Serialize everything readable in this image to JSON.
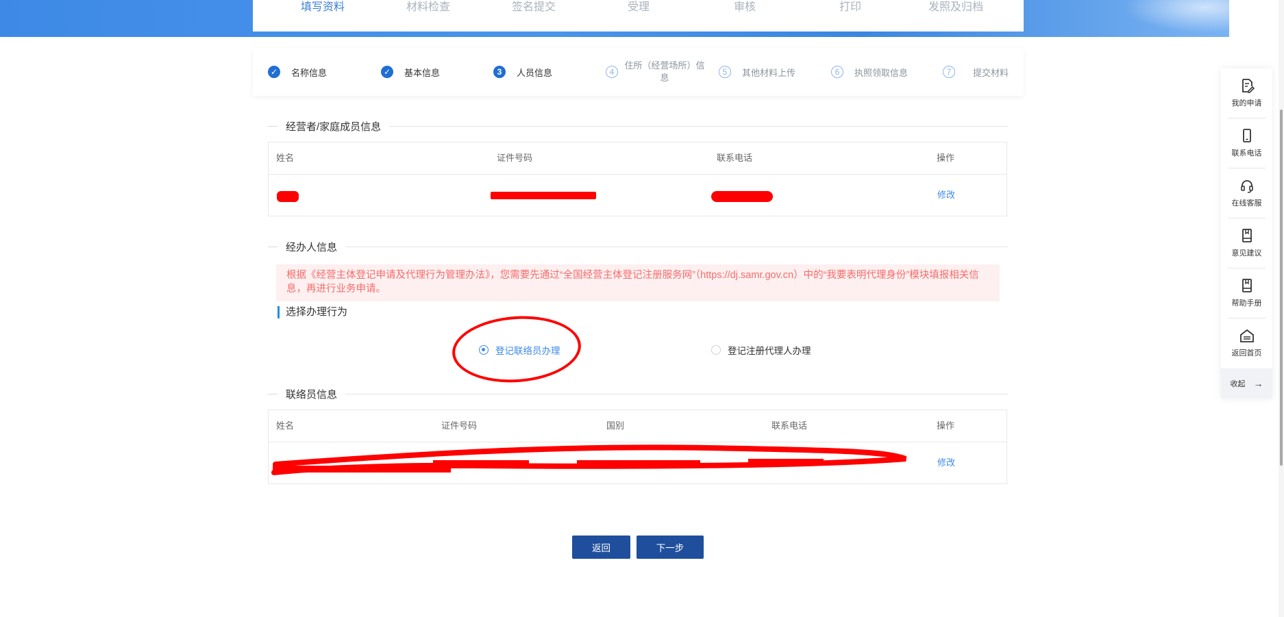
{
  "top_steps": [
    "填写资料",
    "材料检查",
    "签名提交",
    "受理",
    "审核",
    "打印",
    "发照及归档"
  ],
  "sub_steps": [
    {
      "num": "1",
      "label": "名称信息",
      "state": "done"
    },
    {
      "num": "2",
      "label": "基本信息",
      "state": "done"
    },
    {
      "num": "3",
      "label": "人员信息",
      "state": "current"
    },
    {
      "num": "4",
      "label": "住所（经营场所）信息",
      "state": "todo"
    },
    {
      "num": "5",
      "label": "其他材料上传",
      "state": "todo"
    },
    {
      "num": "6",
      "label": "执照领取信息",
      "state": "todo"
    },
    {
      "num": "7",
      "label": "提交材料",
      "state": "todo"
    }
  ],
  "operator_section": {
    "title": "经营者/家庭成员信息",
    "headers": [
      "姓名",
      "证件号码",
      "联系电话",
      "操作"
    ],
    "edit_label": "修改"
  },
  "agent_section": {
    "title": "经办人信息",
    "notice": "根据《经营主体登记申请及代理行为管理办法》，您需要先通过“全国经营主体登记注册服务网”（https://dj.samr.gov.cn）中的“我要表明代理身份”模块填报相关信息，再进行业务申请。",
    "subhead": "选择办理行为",
    "options": [
      {
        "label": "登记联络员办理",
        "checked": true
      },
      {
        "label": "登记注册代理人办理",
        "checked": false
      }
    ]
  },
  "liaison_section": {
    "title": "联络员信息",
    "headers": [
      "姓名",
      "证件号码",
      "国别",
      "联系电话",
      "操作"
    ],
    "edit_label": "修改"
  },
  "buttons": {
    "back": "返回",
    "next": "下一步"
  },
  "sidebar": {
    "items": [
      {
        "label": "我的申请",
        "icon": "edit-doc-icon"
      },
      {
        "label": "联系电话",
        "icon": "phone-icon"
      },
      {
        "label": "在线客服",
        "icon": "headset-icon"
      },
      {
        "label": "意见建议",
        "icon": "bookmark-icon"
      },
      {
        "label": "帮助手册",
        "icon": "manual-icon"
      },
      {
        "label": "返回首页",
        "icon": "home-icon"
      }
    ],
    "collapse_label": "收起"
  },
  "colors": {
    "primary": "#1f4f9c",
    "accent": "#3d8ae6",
    "notice_text": "#f56c6c",
    "notice_bg": "#fef0f0",
    "redaction": "#ff0000"
  }
}
